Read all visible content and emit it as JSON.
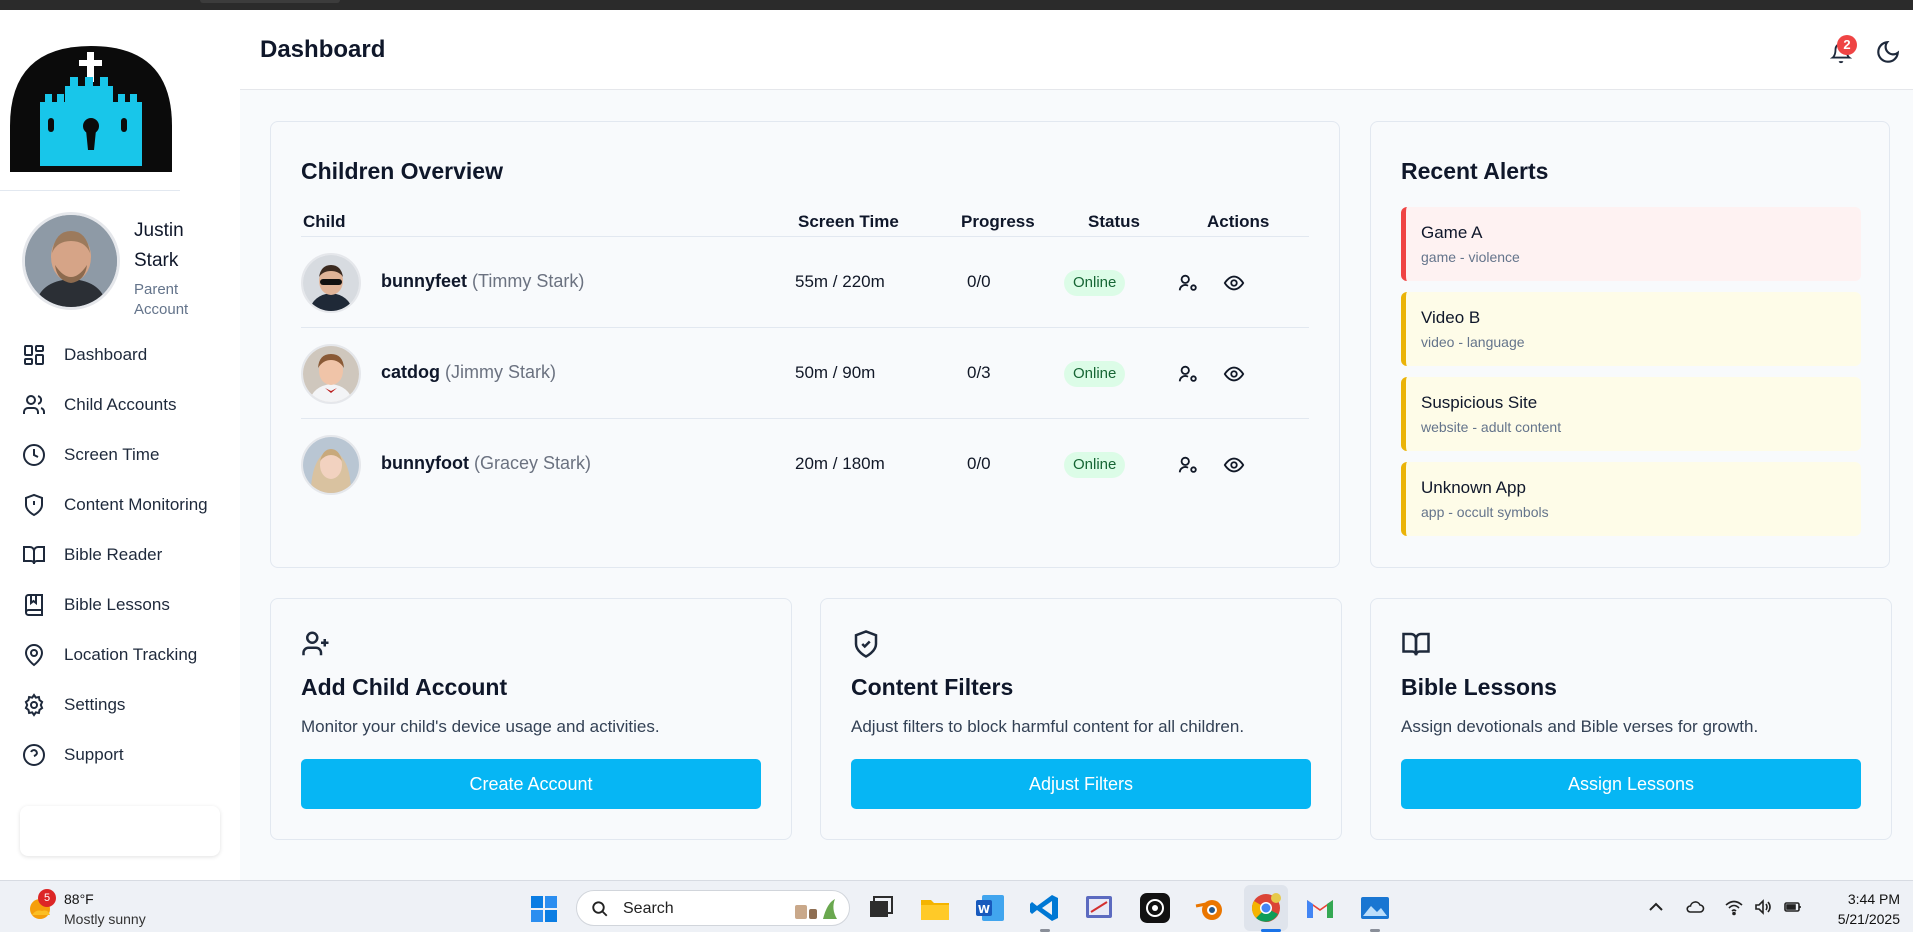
{
  "header": {
    "title": "Dashboard",
    "notification_count": "2"
  },
  "profile": {
    "name": "Justin Stark",
    "role": "Parent Account"
  },
  "sidebar": {
    "items": [
      {
        "label": "Dashboard",
        "icon": "grid-icon"
      },
      {
        "label": "Child Accounts",
        "icon": "users-icon"
      },
      {
        "label": "Screen Time",
        "icon": "clock-icon"
      },
      {
        "label": "Content Monitoring",
        "icon": "shield-alert-icon"
      },
      {
        "label": "Bible Reader",
        "icon": "book-open-icon"
      },
      {
        "label": "Bible Lessons",
        "icon": "book-bookmark-icon"
      },
      {
        "label": "Location Tracking",
        "icon": "map-pin-icon"
      },
      {
        "label": "Settings",
        "icon": "gear-icon"
      },
      {
        "label": "Support",
        "icon": "help-circle-icon"
      }
    ]
  },
  "overview": {
    "title": "Children Overview",
    "columns": {
      "child": "Child",
      "screen_time": "Screen Time",
      "progress": "Progress",
      "status": "Status",
      "actions": "Actions"
    },
    "rows": [
      {
        "username": "bunnyfeet",
        "full_name": "(Timmy Stark)",
        "screen_time": "55m / 220m",
        "progress": "0/0",
        "status": "Online"
      },
      {
        "username": "catdog",
        "full_name": "(Jimmy Stark)",
        "screen_time": "50m / 90m",
        "progress": "0/3",
        "status": "Online"
      },
      {
        "username": "bunnyfoot",
        "full_name": "(Gracey Stark)",
        "screen_time": "20m / 180m",
        "progress": "0/0",
        "status": "Online"
      }
    ]
  },
  "alerts": {
    "title": "Recent Alerts",
    "items": [
      {
        "title": "Game A",
        "detail": "game - violence",
        "severity": "high"
      },
      {
        "title": "Video B",
        "detail": "video - language",
        "severity": "medium"
      },
      {
        "title": "Suspicious Site",
        "detail": "website - adult content",
        "severity": "medium"
      },
      {
        "title": "Unknown App",
        "detail": "app - occult symbols",
        "severity": "medium"
      }
    ]
  },
  "actions": [
    {
      "title": "Add Child Account",
      "desc": "Monitor your child's device usage and activities.",
      "button": "Create Account",
      "icon": "user-plus-icon"
    },
    {
      "title": "Content Filters",
      "desc": "Adjust filters to block harmful content for all children.",
      "button": "Adjust Filters",
      "icon": "shield-check-icon"
    },
    {
      "title": "Bible Lessons",
      "desc": "Assign devotionals and Bible verses for growth.",
      "button": "Assign Lessons",
      "icon": "book-open-icon"
    }
  ],
  "taskbar": {
    "weather_badge": "5",
    "temperature": "88°F",
    "condition": "Mostly sunny",
    "search_label": "Search",
    "time": "3:44 PM",
    "date": "5/21/2025"
  },
  "colors": {
    "accent": "#06b6f4",
    "alert_red": "#ef4444",
    "alert_yellow": "#eab308",
    "online_bg": "#dcfce7"
  }
}
